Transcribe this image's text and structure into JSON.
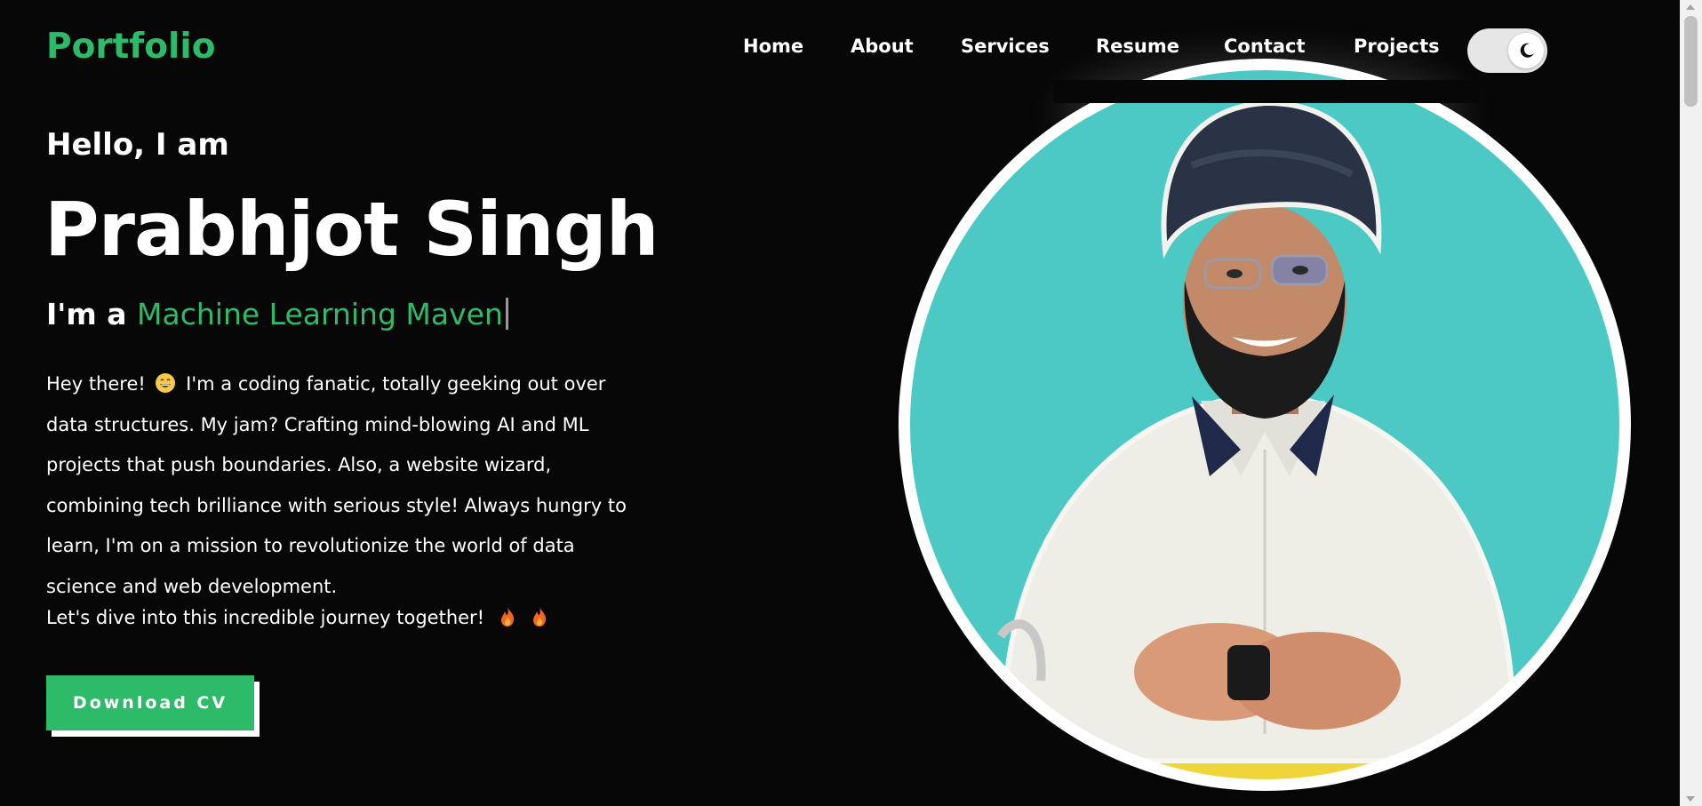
{
  "header": {
    "logo": "Portfolio",
    "nav": [
      {
        "label": "Home"
      },
      {
        "label": "About"
      },
      {
        "label": "Services"
      },
      {
        "label": "Resume"
      },
      {
        "label": "Contact"
      },
      {
        "label": "Projects"
      }
    ],
    "theme_toggle": {
      "icon": "moon-icon",
      "state": "dark"
    }
  },
  "hero": {
    "greeting": "Hello, I am",
    "name": "Prabhjot Singh",
    "role_prefix": "I'm a",
    "role_typed": "Machine Learning Maven",
    "bio_part1": "Hey there!",
    "bio_emoji1": "grinning-face-emoji",
    "bio_part2": "I'm a coding fanatic, totally geeking out over data structures. My jam? Crafting mind-blowing AI and ML projects that push boundaries. Also, a website wizard, combining tech brilliance with serious style! Always hungry to learn, I'm on a mission to revolutionize the world of data science and web development.",
    "bio_line2": "Let's dive into this incredible journey together!",
    "bio_emoji2": "fire-emoji",
    "cv_button": "Download CV"
  },
  "colors": {
    "accent": "#2dbb6a",
    "background": "#070708",
    "photo_background": "#4cc9c4"
  }
}
